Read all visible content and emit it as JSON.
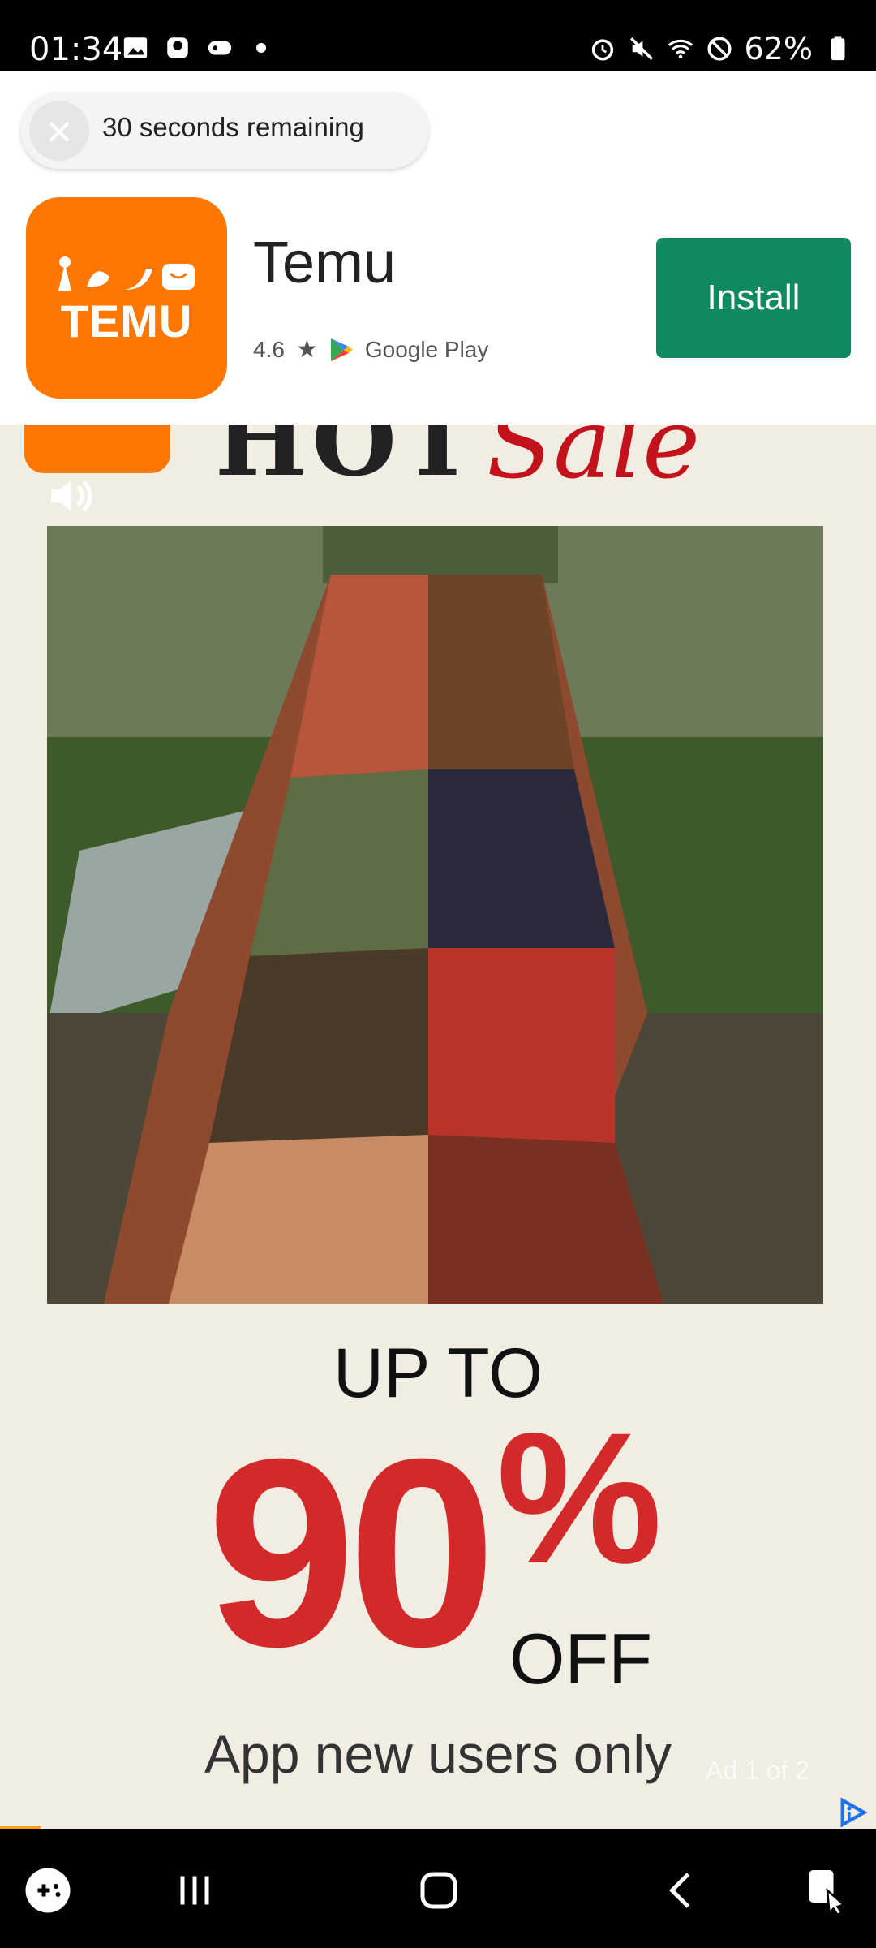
{
  "status_bar": {
    "time": "01:34",
    "battery": "62%"
  },
  "ad": {
    "timer_text": "30 seconds remaining",
    "app_icon_text": "TEMU",
    "app_name": "Temu",
    "rating": "4.6",
    "store": "Google Play",
    "install_label": "Install",
    "brand_color": "#fb7701",
    "install_color": "#0f8a5f"
  },
  "creative": {
    "headline_word_1": "HOT",
    "headline_word_2": "Sale",
    "promo_line_1": "UP TO",
    "promo_number": "90",
    "promo_percent": "%",
    "promo_off": "OFF",
    "promo_sub": "App new users only",
    "ad_counter": "Ad 1 of 2",
    "promo_color": "#d22a2a"
  },
  "nav": {
    "icons": [
      "game-launcher-icon",
      "recent-apps-icon",
      "home-icon",
      "back-icon",
      "assistant-icon"
    ]
  }
}
